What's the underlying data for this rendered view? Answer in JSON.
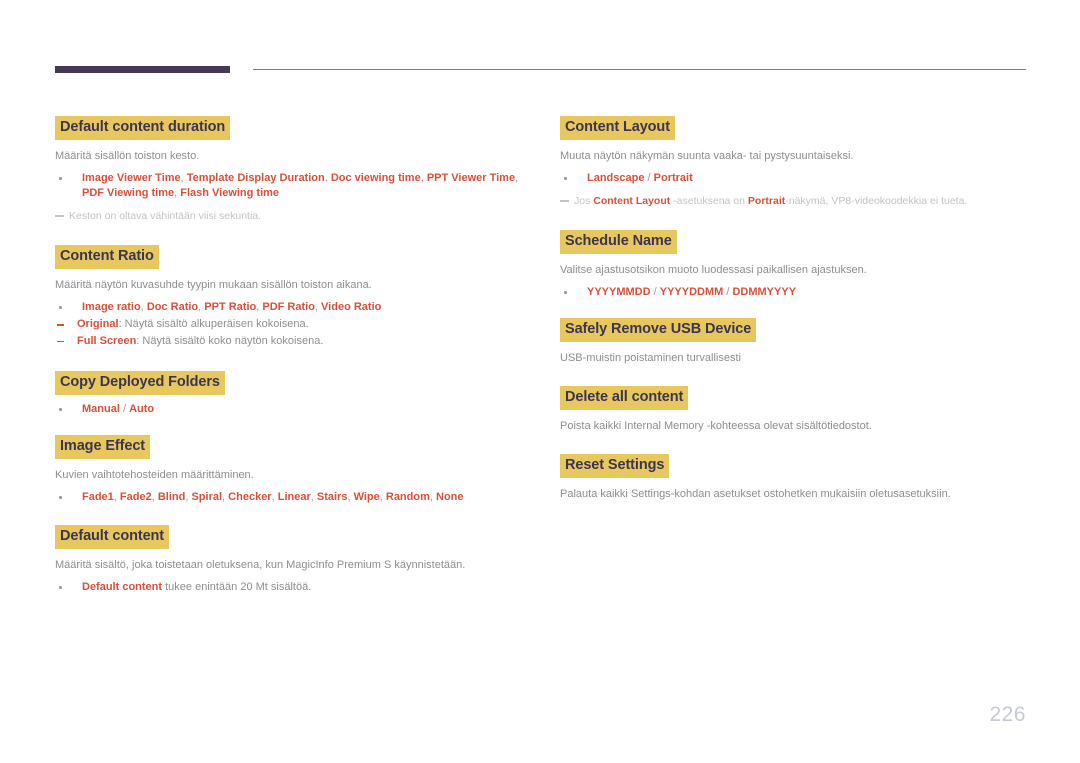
{
  "page": {
    "number": "226"
  },
  "left_column": [
    {
      "heading": "Default content duration",
      "para": "Määritä sisällön toiston kesto.",
      "bullet_terms": [
        "Image Viewer Time",
        "Template Display Duration",
        "Doc viewing time",
        "PPT Viewer Time",
        "PDF Viewing time",
        "Flash Viewing time"
      ],
      "note": "Keston on oltava vähintään viisi sekuntia."
    },
    {
      "heading": "Content Ratio",
      "para": "Määritä näytön kuvasuhde tyypin mukaan sisällön toiston aikana.",
      "bullet_terms": [
        "Image ratio",
        "Doc Ratio",
        "PPT Ratio",
        "PDF Ratio",
        "Video Ratio"
      ],
      "subbullets": [
        {
          "term": "Original",
          "text": ": Näytä sisältö alkuperäisen kokoisena."
        },
        {
          "term": "Full Screen",
          "text": ": Näytä sisältö koko näytön kokoisena."
        }
      ]
    },
    {
      "heading": "Copy Deployed Folders",
      "options": [
        "Manual",
        "Auto"
      ]
    },
    {
      "heading": "Image Effect",
      "para": "Kuvien vaihtotehosteiden määrittäminen.",
      "bullet_terms": [
        "Fade1",
        "Fade2",
        "Blind",
        "Spiral",
        "Checker",
        "Linear",
        "Stairs",
        "Wipe",
        "Random",
        "None"
      ]
    },
    {
      "heading": "Default content",
      "para_parts": [
        {
          "text": "Määritä sisältö, joka toistetaan oletuksena, kun ",
          "style": "plain"
        },
        {
          "text": "MagicInfo Premium S",
          "style": "term"
        },
        {
          "text": " käynnistetään.",
          "style": "plain"
        }
      ],
      "bullet_mixed": [
        {
          "text": "Default content",
          "style": "term"
        },
        {
          "text": " tukee enintään 20 Mt sisältöä.",
          "style": "plain"
        }
      ]
    }
  ],
  "right_column": [
    {
      "heading": "Content Layout",
      "para": "Muuta näytön näkymän suunta vaaka- tai pystysuuntaiseksi.",
      "options": [
        "Landscape",
        "Portrait"
      ],
      "note_parts": [
        {
          "text": "Jos ",
          "style": "plain"
        },
        {
          "text": "Content Layout",
          "style": "term"
        },
        {
          "text": " -asetuksena on ",
          "style": "plain"
        },
        {
          "text": "Portrait",
          "style": "term"
        },
        {
          "text": "-näkymä, VP8-videokoodekkia ei tueta.",
          "style": "plain"
        }
      ]
    },
    {
      "heading": "Schedule Name",
      "para": "Valitse ajastusotsikon muoto luodessasi paikallisen ajastuksen.",
      "options": [
        "YYYYMMDD",
        "YYYYDDMM",
        "DDMMYYYY"
      ]
    },
    {
      "heading": "Safely Remove USB Device",
      "para": "USB-muistin poistaminen turvallisesti"
    },
    {
      "heading": "Delete all content",
      "para_parts": [
        {
          "text": "Poista kaikki ",
          "style": "plain"
        },
        {
          "text": "Internal Memory",
          "style": "term"
        },
        {
          "text": " -kohteessa olevat sisältötiedostot.",
          "style": "plain"
        }
      ]
    },
    {
      "heading": "Reset Settings",
      "para_parts": [
        {
          "text": "Palauta kaikki ",
          "style": "plain"
        },
        {
          "text": "Settings",
          "style": "term"
        },
        {
          "text": "-kohdan asetukset ostohetken mukaisiin oletusasetuksiin.",
          "style": "plain"
        }
      ]
    }
  ]
}
